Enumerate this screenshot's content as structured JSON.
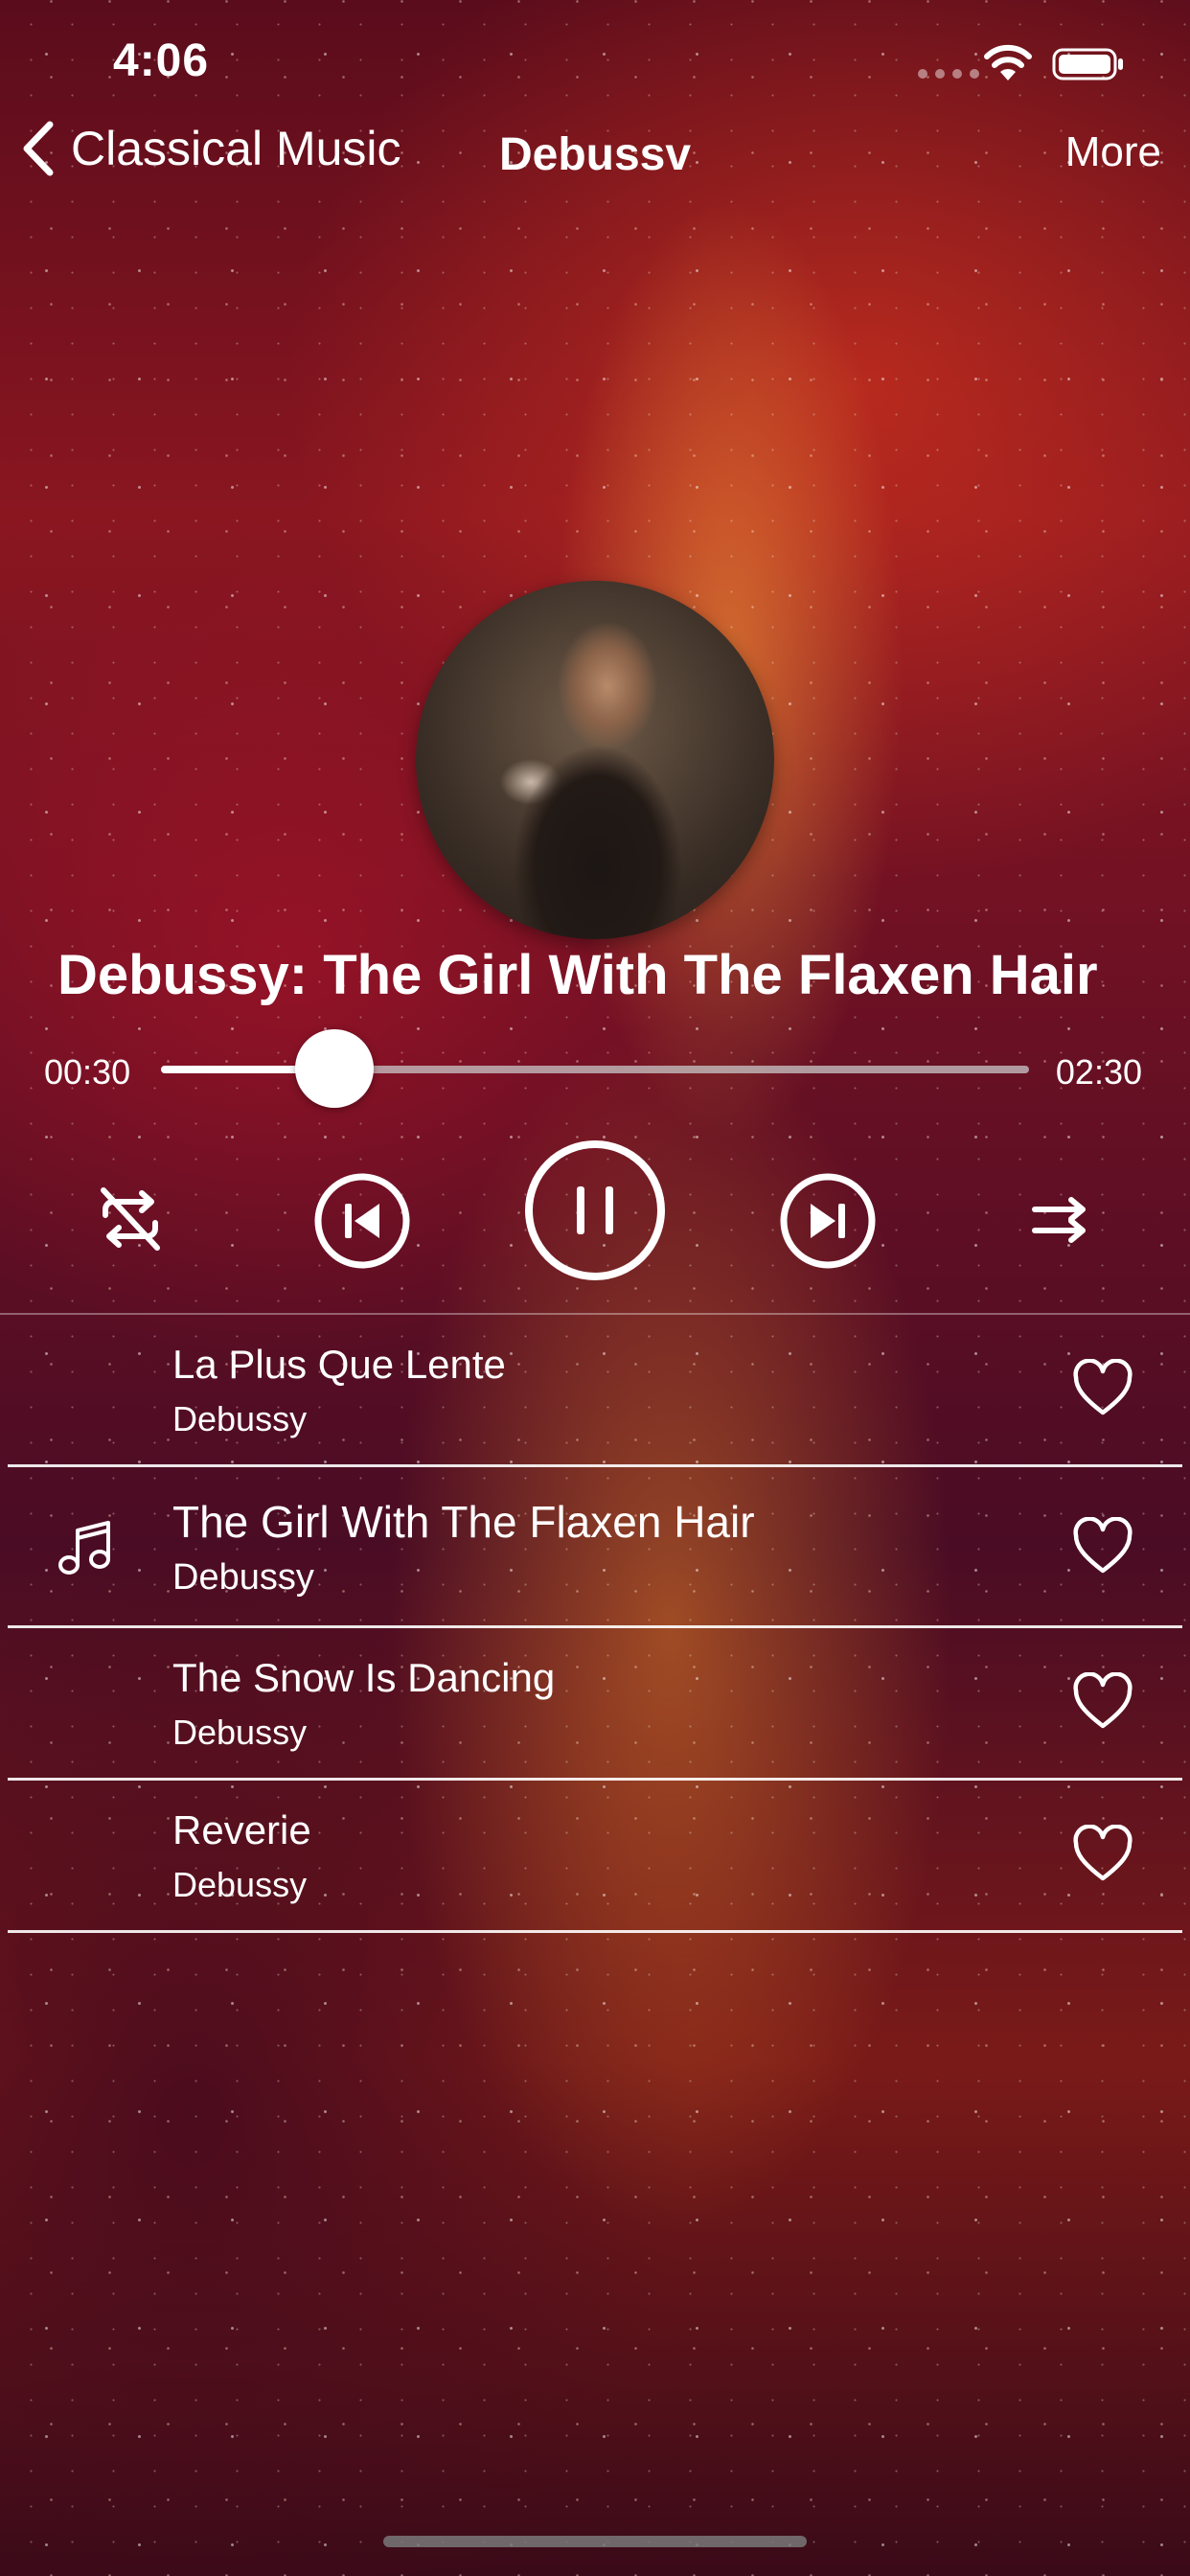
{
  "status_bar": {
    "time": "4:06"
  },
  "nav": {
    "back_label": "Classical Music",
    "title": "Debussv",
    "more_label": "More"
  },
  "now_playing": {
    "title": "Debussy: The Girl With The Flaxen Hair",
    "elapsed": "00:30",
    "total": "02:30",
    "progress_fraction": 0.2
  },
  "controls": {
    "repeat_icon": "repeat-off-icon",
    "prev_icon": "skip-previous-icon",
    "play_pause_icon": "pause-icon",
    "next_icon": "skip-next-icon",
    "shuffle_icon": "shuffle-icon"
  },
  "playlist": [
    {
      "title": "La Plus Que Lente",
      "artist": "Debussy",
      "playing": false
    },
    {
      "title": "The Girl With The Flaxen Hair",
      "artist": "Debussy",
      "playing": true
    },
    {
      "title": "The Snow Is Dancing",
      "artist": "Debussy",
      "playing": false
    },
    {
      "title": "Reverie",
      "artist": "Debussy",
      "playing": false
    }
  ]
}
